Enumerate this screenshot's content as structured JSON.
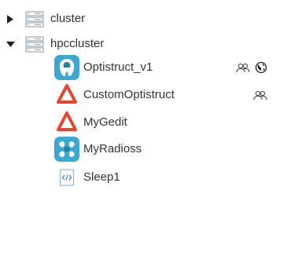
{
  "tree": {
    "clusters": [
      {
        "label": "cluster",
        "expanded": false,
        "toggle_icon": "caret-right-icon",
        "icon": "server-rack-icon"
      },
      {
        "label": "hpccluster",
        "expanded": true,
        "toggle_icon": "caret-down-icon",
        "icon": "server-rack-icon"
      }
    ],
    "apps": [
      {
        "label": "Optistruct_v1",
        "icon": "optistruct-app-icon",
        "badges": [
          "users-icon",
          "globe-icon"
        ]
      },
      {
        "label": "CustomOptistruct",
        "icon": "altair-logo-icon",
        "badges": [
          "users-icon"
        ]
      },
      {
        "label": "MyGedit",
        "icon": "altair-logo-icon",
        "badges": []
      },
      {
        "label": "MyRadioss",
        "icon": "radioss-app-icon",
        "badges": []
      },
      {
        "label": "Sleep1",
        "icon": "script-file-icon",
        "badges": []
      }
    ]
  },
  "colors": {
    "altair_red": "#e8452c",
    "teal": "#3aa8d0",
    "teal_dark": "#1e7fa6",
    "rack_gray": "#9aa7b5",
    "text": "#333333"
  }
}
